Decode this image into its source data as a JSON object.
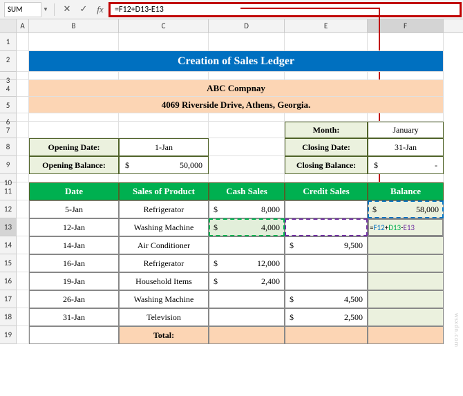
{
  "formula_bar": {
    "name_box": "SUM",
    "formula": "=F12+D13-E13"
  },
  "columns": [
    "A",
    "B",
    "C",
    "D",
    "E",
    "F"
  ],
  "rows": [
    "1",
    "2",
    "3",
    "4",
    "5",
    "6",
    "7",
    "8",
    "9",
    "10",
    "11",
    "12",
    "13",
    "14",
    "15",
    "16",
    "17",
    "18",
    "19"
  ],
  "title": "Creation of Sales Ledger",
  "company": {
    "name": "ABC Compnay",
    "address": "4069 Riverside Drive, Athens, Georgia."
  },
  "info": {
    "month_label": "Month:",
    "month_value": "January",
    "opening_date_label": "Opening Date:",
    "opening_date_value": "1-Jan",
    "closing_date_label": "Closing Date:",
    "closing_date_value": "31-Jan",
    "opening_balance_label": "Opening Balance:",
    "opening_balance_value": "50,000",
    "closing_balance_label": "Closing Balance:",
    "closing_balance_value": "-",
    "currency": "$"
  },
  "headers": {
    "date": "Date",
    "product": "Sales of Product",
    "cash": "Cash Sales",
    "credit": "Credit Sales",
    "balance": "Balance"
  },
  "data": [
    {
      "date": "5-Jan",
      "product": "Refrigerator",
      "cash": "8,000",
      "credit": "",
      "balance": "58,000"
    },
    {
      "date": "12-Jan",
      "product": "Washing Machine",
      "cash": "4,000",
      "credit": "",
      "balance": "=F12+D13-E13"
    },
    {
      "date": "14-Jan",
      "product": "Air Conditioner",
      "cash": "",
      "credit": "9,500",
      "balance": ""
    },
    {
      "date": "16-Jan",
      "product": "Refrigerator",
      "cash": "12,000",
      "credit": "",
      "balance": ""
    },
    {
      "date": "19-Jan",
      "product": "Household Items",
      "cash": "2,400",
      "credit": "",
      "balance": ""
    },
    {
      "date": "26-Jan",
      "product": "Washing Machine",
      "cash": "",
      "credit": "4,500",
      "balance": ""
    },
    {
      "date": "31-Jan",
      "product": "Television",
      "cash": "",
      "credit": "2,500",
      "balance": ""
    }
  ],
  "total_label": "Total:",
  "watermark": "wsxdn.com",
  "formula_parts": {
    "p1": "=",
    "p2": "F12",
    "p3": "+",
    "p4": "D13",
    "p5": "-",
    "p6": "E13"
  }
}
